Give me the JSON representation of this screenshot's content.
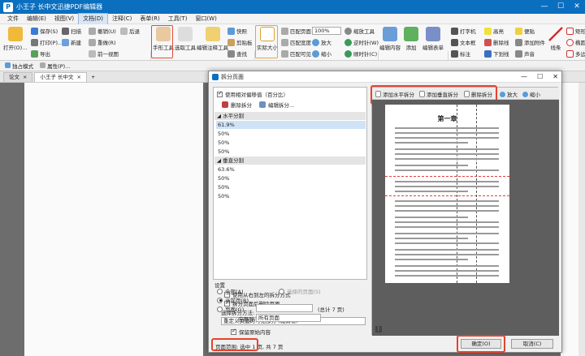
{
  "window": {
    "title": "小王子 长中文迅捷PDF编辑器",
    "logo_letter": "P",
    "min": "—",
    "max": "☐",
    "close": "✕"
  },
  "menu": [
    "文件",
    "编辑(E)",
    "视图(V)",
    "文档(D)",
    "注释(C)",
    "表单(R)",
    "工具(T)",
    "窗口(W)"
  ],
  "menu_active_index": 3,
  "ribbon": {
    "open": "打开(O)...",
    "save": "保存(S)",
    "print": "打印(P)...",
    "export": "导出",
    "scan": "扫描",
    "new": "新建",
    "undo": "撤销(U)",
    "redo": "重做(R)",
    "prev_view": "前一视图",
    "back": "后退",
    "hand": "手形工具",
    "select_text": "选取工具",
    "edit_annot": "编辑注释工具",
    "snapshot": "快照",
    "clipboard": "剪贴板",
    "find": "查找",
    "actual_size": "实际大小",
    "fit_page": "匹配页面",
    "fit_width": "匹配宽度",
    "fit_visible": "匹配可见",
    "zoom_value": "100%",
    "zoom_in": "放大",
    "zoom_out": "缩小",
    "zoom_tool": "缩放工具",
    "rotate_ccw": "逆时针(W)",
    "rotate_cw": "顺时针(C)",
    "edit_content": "编辑内容",
    "add": "添加",
    "edit_form": "编辑表单",
    "typewriter": "打字机",
    "textbox": "文本框",
    "callout": "标注",
    "highlight": "高亮",
    "strikeout": "删除线",
    "underline": "下划线",
    "note": "便贴",
    "attach": "添加附件",
    "sound": "声音",
    "line": "线条",
    "rect": "矩形",
    "ellipse": "椭圆",
    "polygon": "多边形"
  },
  "quickbar": {
    "standalone": "独占模式",
    "properties": "属性(P)..."
  },
  "tabs": [
    {
      "label": "论文"
    },
    {
      "label": "小王子 长中文"
    }
  ],
  "tab_close": "×",
  "tab_add": "+",
  "dialog": {
    "title": "拆分页面",
    "use_relative": "使用相对偏移值（百分比）",
    "delete_split": "删除拆分",
    "edit_split": "编辑拆分...",
    "horizontal_header": "水平分割",
    "horizontal_values": [
      "61.9%",
      "50%",
      "50%",
      "50%"
    ],
    "vertical_header": "垂直分割",
    "vertical_values": [
      "63.6%",
      "50%",
      "50%",
      "50%"
    ],
    "settings_label": "设置",
    "opt_right_to_left": "使用从右到左的拆分方式",
    "opt_delete_blank": "拆分页面后删除页面",
    "split_method_label": "选择拆分方法:",
    "split_method_value": "重定义页面的可见部分 (裁剪框)",
    "keep_original": "保留原始内容",
    "page_range_label": "页面范围: 选中 1 页, 共 7 页",
    "range_all": "全部(A)",
    "range_selected": "选择的页面(S)",
    "range_current": "当前页(R)",
    "range_pages": "页面(G)",
    "pages_total": "(总计 7 页)",
    "apply_to_label": "应用到:",
    "apply_to_value": "所有页面",
    "preview_add_h": "添加水平拆分",
    "preview_add_v": "添加垂直拆分",
    "preview_delete": "删除拆分",
    "preview_zoom_in": "放大",
    "preview_zoom_out": "缩小",
    "chapter_title": "第一章",
    "ok": "确定(O)",
    "cancel": "取消(C)"
  },
  "colors": {
    "accent": "#0b6fc0",
    "highlight_red": "#e5432f",
    "selected_row": "#cfe3f7"
  }
}
